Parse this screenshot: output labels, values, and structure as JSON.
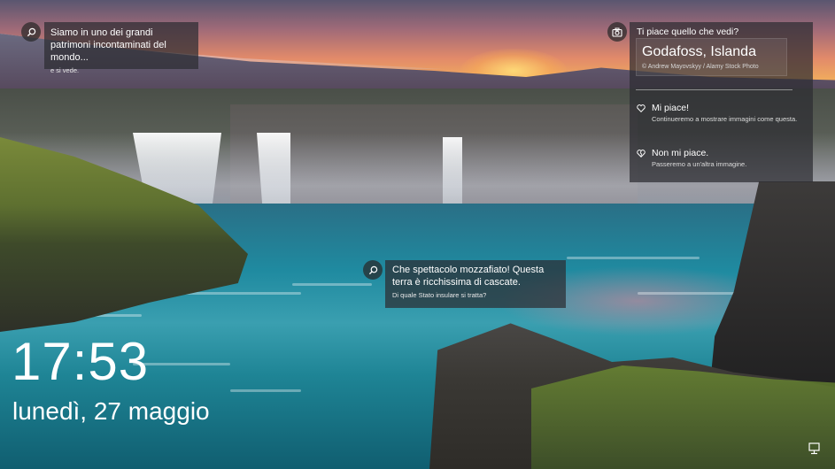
{
  "lock_screen": {
    "time": "17:53",
    "date": "lunedì, 27 maggio"
  },
  "tips": {
    "top_left": {
      "icon": "search-icon",
      "text": "Siamo in uno dei grandi patrimoni incontaminati del mondo...",
      "subtext": "e si vede."
    },
    "center": {
      "icon": "search-icon",
      "text": "Che spettacolo mozzafiato! Questa terra è ricchissima di cascate.",
      "subtext": "Di quale Stato insulare si tratta?"
    }
  },
  "like_panel": {
    "icon": "camera-icon",
    "header": "Ti piace quello che vedi?",
    "location": "Godafoss, Islanda",
    "credit": "© Andrew Mayovskyy / Alamy Stock Photo",
    "options": [
      {
        "icon": "heart-icon",
        "label": "Mi piace!",
        "description": "Continueremo a mostrare immagini come questa."
      },
      {
        "icon": "heart-broken-icon",
        "label": "Non mi piace.",
        "description": "Passeremo a un'altra immagine."
      }
    ]
  },
  "tray": {
    "icon": "network-icon"
  }
}
